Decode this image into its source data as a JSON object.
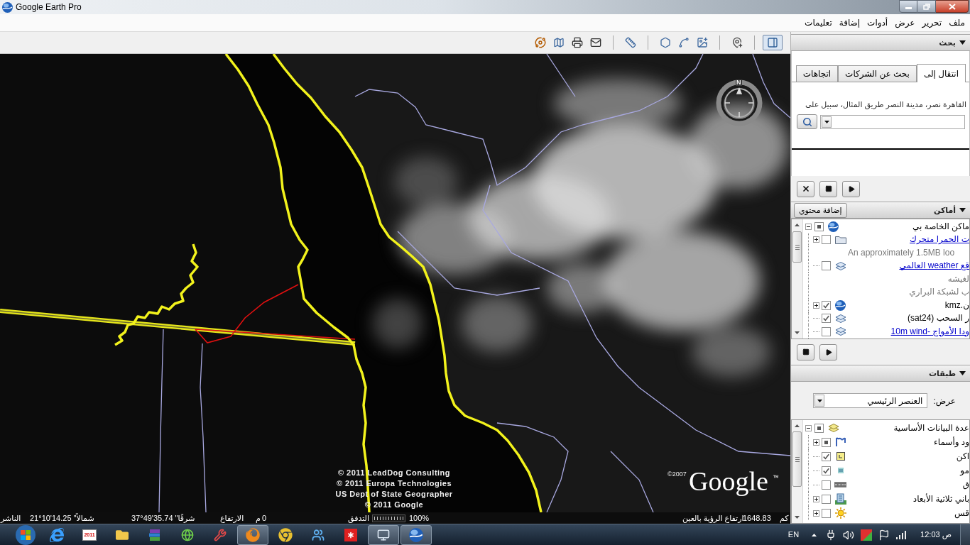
{
  "window": {
    "title": "Google Earth Pro"
  },
  "menu": [
    {
      "label": "ملف"
    },
    {
      "label": "تحرير"
    },
    {
      "label": "عرض"
    },
    {
      "label": "أدوات"
    },
    {
      "label": "إضافة"
    },
    {
      "label": "تعليمات"
    }
  ],
  "toolbar": [
    {
      "buttons": [
        {
          "kind": "sky",
          "pressed": false
        },
        {
          "kind": "map",
          "pressed": false
        },
        {
          "kind": "print",
          "pressed": false
        },
        {
          "kind": "email",
          "pressed": false
        }
      ]
    },
    {
      "buttons": [
        {
          "kind": "ruler",
          "pressed": false
        }
      ]
    },
    {
      "buttons": [
        {
          "kind": "polygon",
          "pressed": false
        },
        {
          "kind": "path",
          "pressed": false
        },
        {
          "kind": "overlay",
          "pressed": false
        }
      ]
    },
    {
      "buttons": [
        {
          "kind": "placemark",
          "pressed": false
        }
      ]
    },
    {
      "buttons": [
        {
          "kind": "sidebar",
          "pressed": true
        }
      ]
    }
  ],
  "map": {
    "compass_label": "N",
    "copyright": [
      "© 2011 LeadDog Consulting",
      "© 2011 Europa Technologies",
      "US Dept of State Geographer",
      "© 2011 Google"
    ],
    "logo": {
      "year": "©2007",
      "name": "Google",
      "mark": "™"
    }
  },
  "search_panel": {
    "title": "بحث",
    "expanded": true,
    "tabs": [
      {
        "label": "انتقال إلى",
        "selected": true
      },
      {
        "label": "بحث عن الشركات",
        "selected": false
      },
      {
        "label": "اتجاهات",
        "selected": false
      }
    ],
    "hint": "على سبيل المثال، طريق النصر مدينة نصر، القاهرة"
  },
  "places_panel": {
    "title": "أماكن",
    "expanded": true,
    "add_button": "إضافة محتوي",
    "items": [
      {
        "kind": "globe",
        "label": "ماكن الخاصة بي",
        "link": false,
        "mixed": true,
        "expanded": true,
        "children": [
          {
            "kind": "folder",
            "label": "ت الحمرا متحرك",
            "link": true,
            "checked": false,
            "expanded": false,
            "snippet": [
              "An approximately 1.5MB loo"
            ]
          },
          {
            "kind": "layer",
            "label": "قع weather العالمي",
            "link": true,
            "checked": false,
            "snippet": [
              "لغيشه",
              "ب لشبكة البراري"
            ]
          },
          {
            "kind": "globe",
            "label": "ن.kmz",
            "link": false,
            "checked": true,
            "expanded": false
          },
          {
            "kind": "layer",
            "label": "ر السحب (sat24)",
            "link": false,
            "checked": true
          },
          {
            "kind": "layer",
            "label": "ودا الأمواج -10m wind",
            "link": true,
            "checked": false
          }
        ]
      }
    ]
  },
  "layers_panel": {
    "title": "طبقات",
    "expanded": true,
    "view_label": "عرض:",
    "view_value": "العنصر الرئيسي",
    "items": [
      {
        "kind": "base",
        "label": "عدة البيانات الأساسية",
        "mixed": true,
        "expanded": true,
        "children": [
          {
            "kind": "borders",
            "label": "ود وأسماء",
            "mixed": true,
            "expanded": false
          },
          {
            "kind": "places",
            "label": "اكن",
            "checked": true
          },
          {
            "kind": "photos",
            "label": "مو",
            "checked": true
          },
          {
            "kind": "roads",
            "label": "ق",
            "checked": false
          },
          {
            "kind": "buildings",
            "label": "باني ثلاثية الأبعاد",
            "checked": false,
            "expanded": false
          },
          {
            "kind": "weather",
            "label": "قس",
            "checked": false,
            "expanded": false
          }
        ]
      }
    ]
  },
  "status_bar": {
    "publisher": "الناشر",
    "latitude": "21°10'14.25 \"شمالاً",
    "longitude": "37°49'35.74 \"شرقًا",
    "elevation_label": "الارتفاع",
    "elevation_unit": "م",
    "elevation": "0",
    "streaming_label": "التدفق",
    "streaming": {
      "level": 1
    },
    "streaming_reading": "100%",
    "eye_alt_label": "ارتفاع الرؤية بالعين",
    "eye_alt": "1648.83",
    "eye_alt_unit": "كم"
  },
  "taskbar": {
    "apps": [
      {
        "kind": "ie",
        "active": false
      },
      {
        "kind": "calendar",
        "label": "2011",
        "active": false
      },
      {
        "kind": "folder",
        "active": false
      },
      {
        "kind": "books",
        "active": false
      },
      {
        "kind": "network",
        "active": false
      },
      {
        "kind": "tool",
        "active": false
      },
      {
        "kind": "firefox",
        "active": true
      },
      {
        "kind": "chrome",
        "active": false
      },
      {
        "kind": "people",
        "active": false
      },
      {
        "kind": "red",
        "active": false
      },
      {
        "kind": "remote",
        "active": true
      },
      {
        "kind": "earth",
        "active": true
      }
    ],
    "language": "EN",
    "clock": "12:03 ص"
  }
}
